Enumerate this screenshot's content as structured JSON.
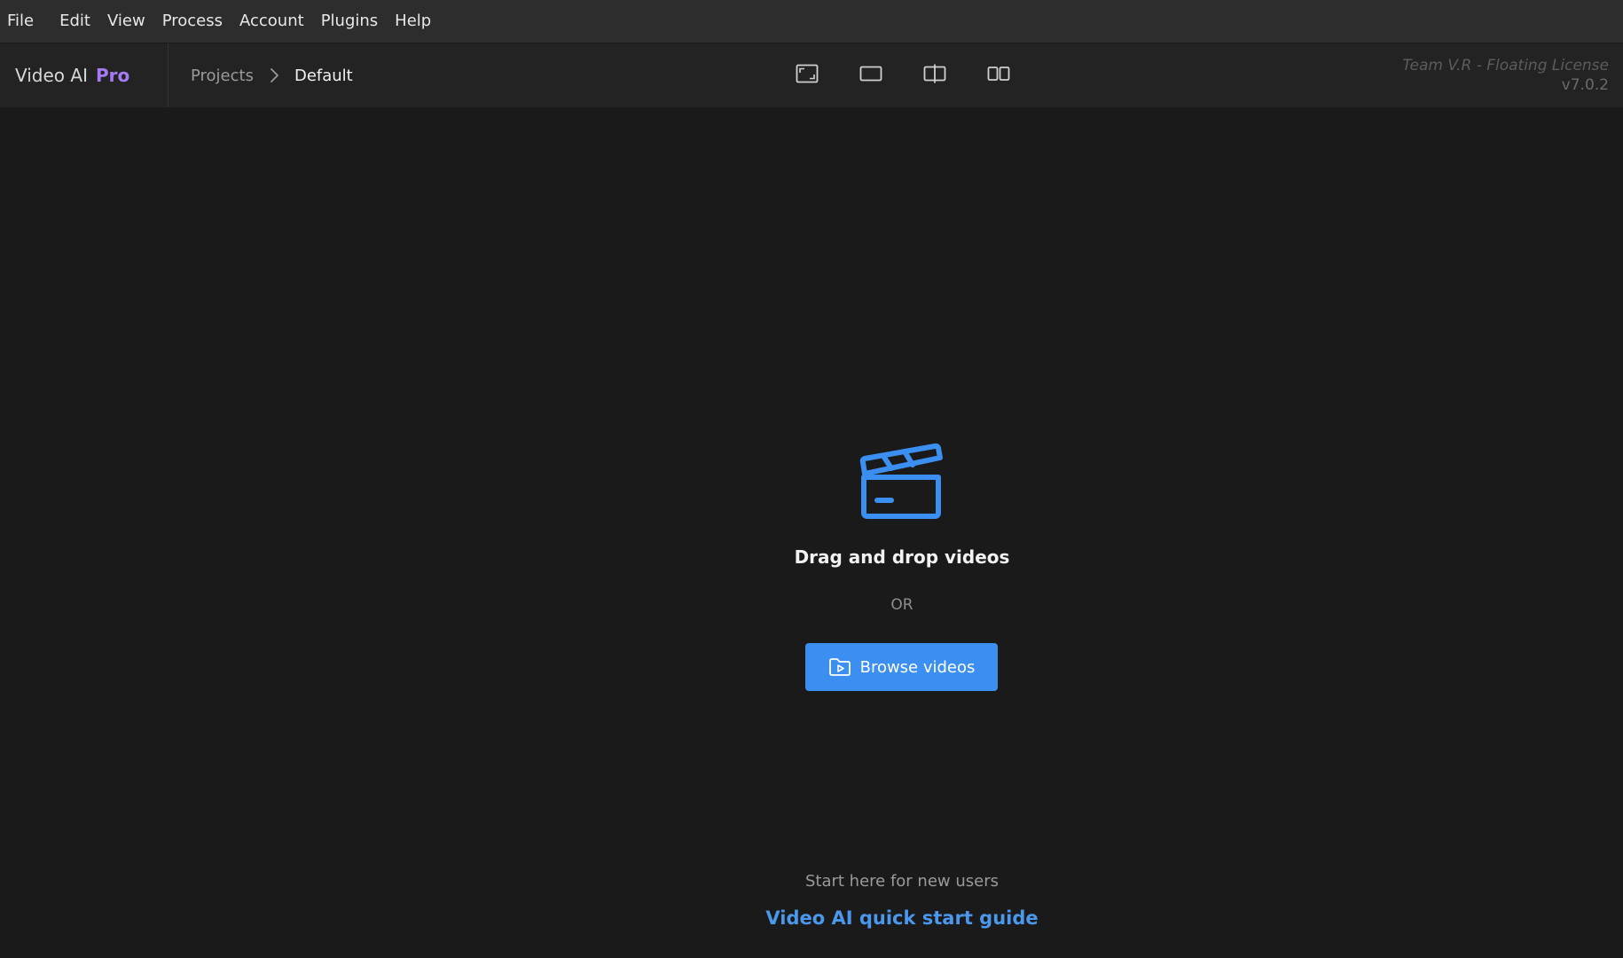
{
  "menubar": {
    "items": [
      {
        "label": "File"
      },
      {
        "label": "Edit"
      },
      {
        "label": "View"
      },
      {
        "label": "Process"
      },
      {
        "label": "Account"
      },
      {
        "label": "Plugins"
      },
      {
        "label": "Help"
      }
    ]
  },
  "brand": {
    "name": "Video AI",
    "tier": "Pro",
    "tier_color": "#a77af5"
  },
  "breadcrumb": {
    "root": "Projects",
    "current": "Default",
    "separator_icon": "chevron-right-icon"
  },
  "view_modes": [
    {
      "name": "view-crop-icon"
    },
    {
      "name": "view-single-icon"
    },
    {
      "name": "view-split-icon"
    },
    {
      "name": "view-side-by-side-icon"
    }
  ],
  "license": {
    "name": "Team V.R - Floating License",
    "version": "v7.0.2"
  },
  "dropzone": {
    "icon": "clapperboard-icon",
    "title": "Drag and drop videos",
    "or": "OR",
    "browse_label": "Browse videos",
    "browse_icon": "folder-play-icon",
    "accent_color": "#3b8ff0"
  },
  "footer": {
    "hint": "Start here for new users",
    "guide_link": "Video AI quick start guide",
    "link_color": "#4a97ec"
  }
}
